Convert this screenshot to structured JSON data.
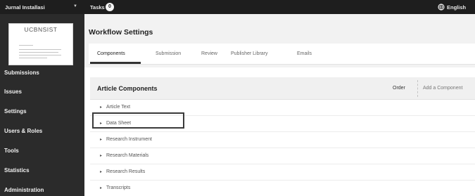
{
  "topbar": {
    "journal_label": "Jurnal Installasi",
    "caret": "▼",
    "tasks_label": "Tasks",
    "tasks_count": "0",
    "language_label": "English"
  },
  "sidebar": {
    "logo_text": "UCBNSIST",
    "items": [
      {
        "label": "Submissions"
      },
      {
        "label": "Issues"
      },
      {
        "label": "Settings"
      },
      {
        "label": "Users & Roles"
      },
      {
        "label": "Tools"
      },
      {
        "label": "Statistics"
      },
      {
        "label": "Administration"
      }
    ]
  },
  "main": {
    "title": "Workflow Settings",
    "tabs": [
      {
        "label": "Components",
        "active": true
      },
      {
        "label": "Submission"
      },
      {
        "label": "Review"
      },
      {
        "label": "Publisher Library"
      },
      {
        "label": "Emails"
      }
    ],
    "panel": {
      "title": "Article Components",
      "order_label": "Order",
      "add_label": "Add a Component",
      "rows": [
        {
          "label": "Article Text"
        },
        {
          "label": "Data Sheet"
        },
        {
          "label": "Research Instrument"
        },
        {
          "label": "Research Materials"
        },
        {
          "label": "Research Results"
        },
        {
          "label": "Transcripts"
        }
      ],
      "row_arrow": "▸"
    }
  },
  "colors": {
    "topbar": "#1e1e1e",
    "sidebar": "#2b2b2b",
    "header_bg": "#f2f2f2"
  }
}
